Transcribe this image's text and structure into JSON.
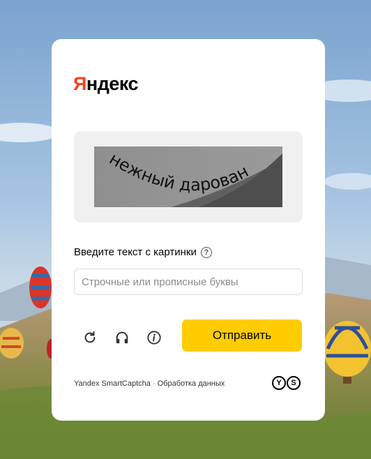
{
  "brand": {
    "first_letter": "Я",
    "rest": "ндекс"
  },
  "captcha": {
    "text": "нежный дарован"
  },
  "prompt": {
    "label": "Введите текст с картинки",
    "help_glyph": "?"
  },
  "input": {
    "placeholder": "Строчные или прописные буквы",
    "value": ""
  },
  "actions": {
    "refresh_icon": "refresh-icon",
    "audio_icon": "headphones-icon",
    "info_icon": "info-icon",
    "submit_label": "Отправить"
  },
  "footer": {
    "product": "Yandex SmartCaptcha",
    "separator": "·",
    "data_link": "Обработка данных"
  },
  "badge": {
    "letters": [
      "Y",
      "S"
    ]
  },
  "colors": {
    "brand_red": "#fc3f1d",
    "submit_yellow": "#ffcc00",
    "captcha_box_bg": "#f0f0f0"
  }
}
